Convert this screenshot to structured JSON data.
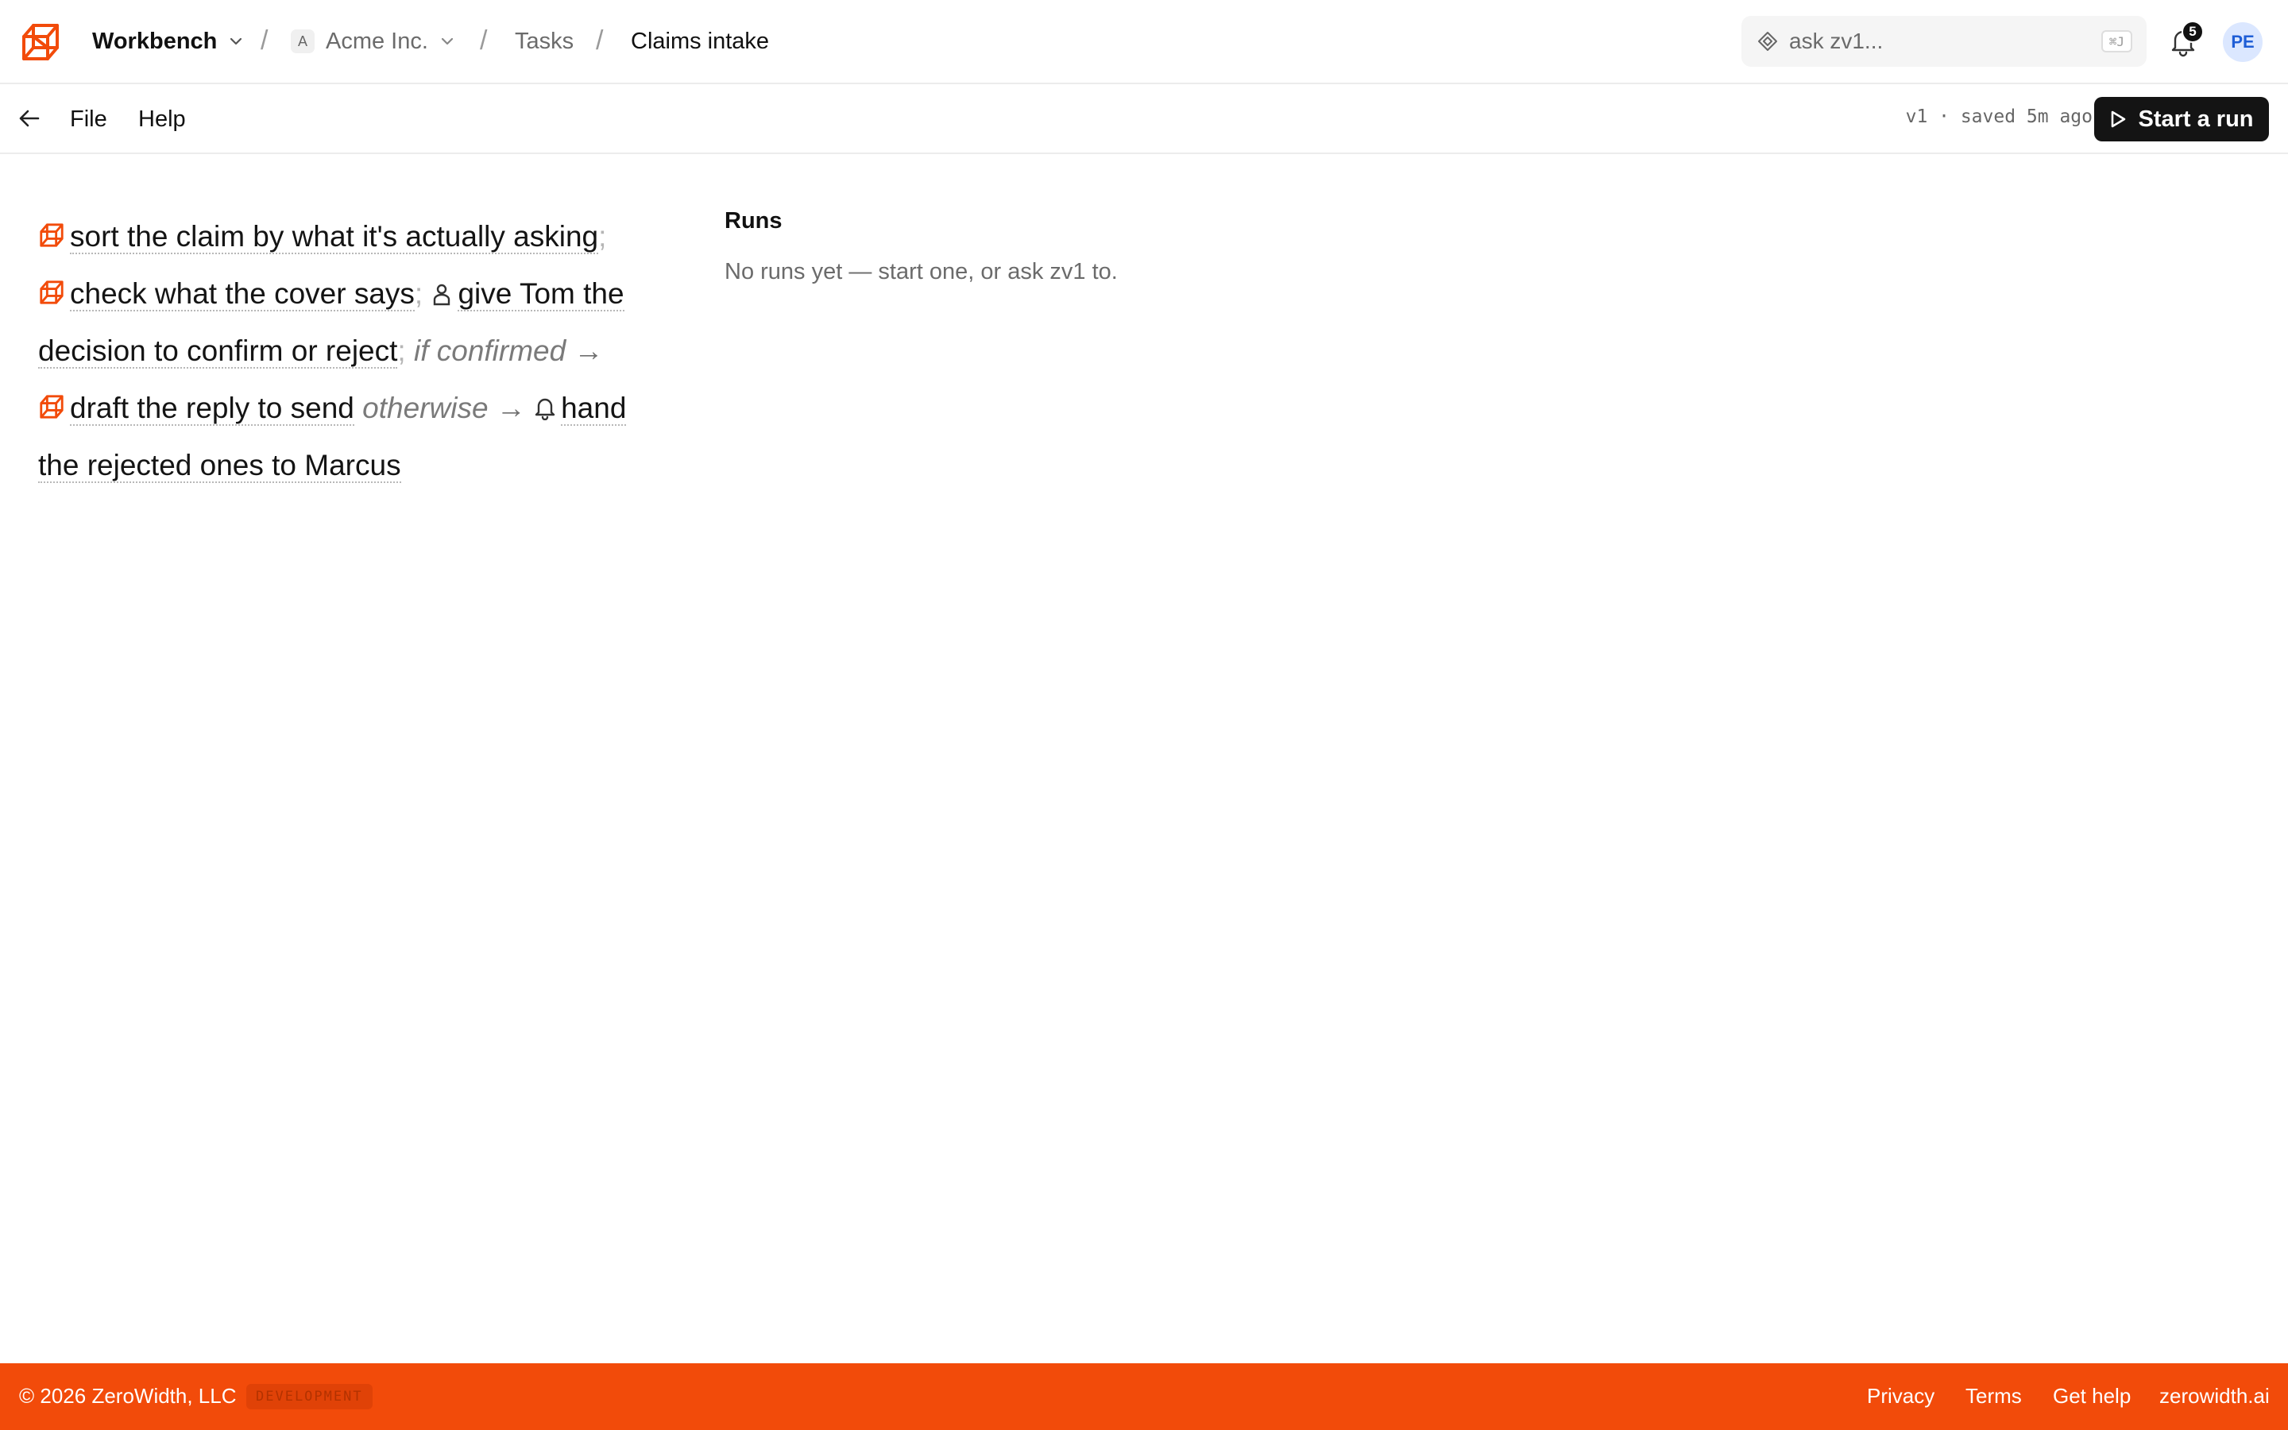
{
  "header": {
    "workspace": "Workbench",
    "org_initial": "A",
    "org": "Acme Inc.",
    "section": "Tasks",
    "current": "Claims intake",
    "separator": "/",
    "search_placeholder": "ask zv1...",
    "search_shortcut": "⌘J",
    "notification_count": "5",
    "avatar_initials": "PE"
  },
  "toolbar": {
    "file_label": "File",
    "help_label": "Help",
    "save_status": "v1 · saved 5m ago",
    "run_label": "Start a run"
  },
  "flow": {
    "step1": "sort the claim by what it's actually asking",
    "step2": "check what the cover says",
    "step3": "give Tom the decision to confirm or reject",
    "cond_true": "if confirmed",
    "step4": "draft the reply to send",
    "cond_false": "otherwise",
    "step5": "hand the rejected ones to Marcus",
    "semicolon": ";",
    "arrow": "→"
  },
  "runs": {
    "title": "Runs",
    "empty": "No runs yet — start one, or ask zv1 to."
  },
  "footer": {
    "copyright": "© 2026 ZeroWidth, LLC",
    "env_badge": "DEVELOPMENT",
    "privacy": "Privacy",
    "terms": "Terms",
    "help": "Get help",
    "site": "zerowidth.ai"
  },
  "colors": {
    "brand": "#f24b0a",
    "primary_button": "#141414",
    "avatar_bg": "#dbe7ff",
    "avatar_text": "#1f5ed6"
  }
}
